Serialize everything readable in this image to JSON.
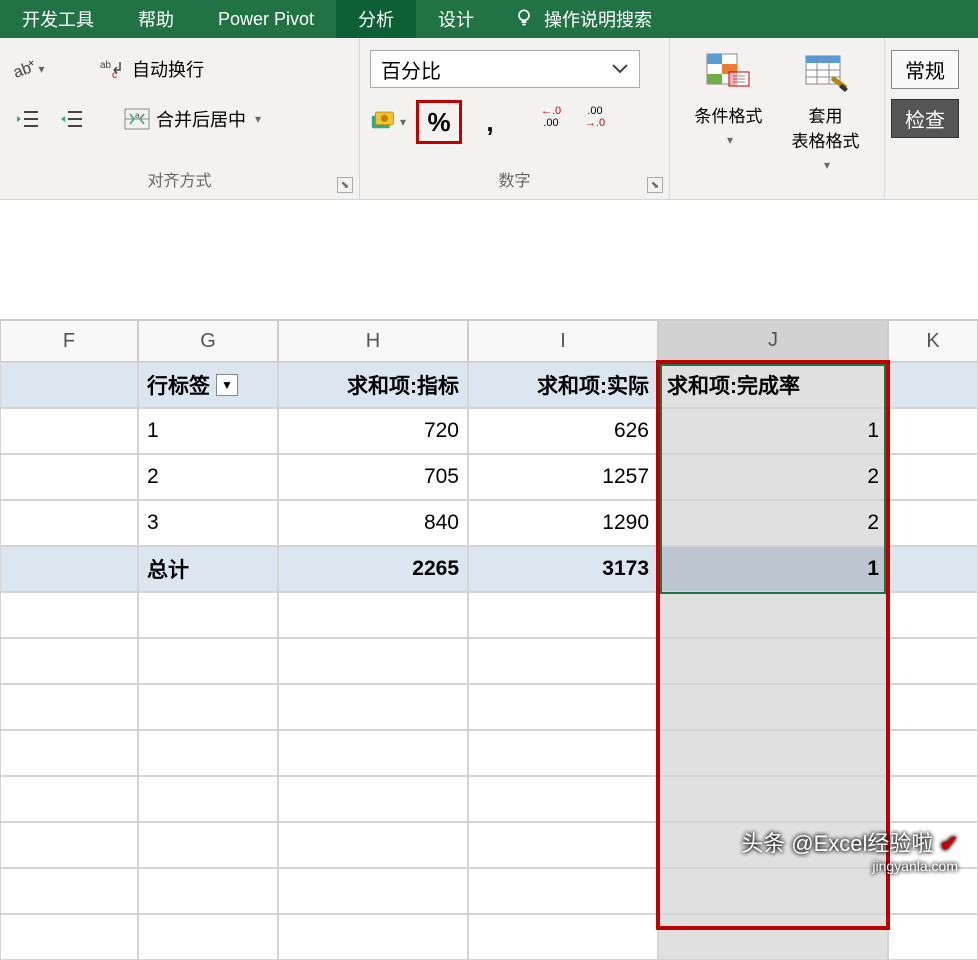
{
  "ribbon": {
    "tabs": {
      "dev": "开发工具",
      "help": "帮助",
      "powerpivot": "Power Pivot",
      "analyze": "分析",
      "design": "设计"
    },
    "tellme": "操作说明搜索",
    "align": {
      "wrap": "自动换行",
      "merge": "合并后居中",
      "group_label": "对齐方式"
    },
    "number": {
      "format": "百分比",
      "group_label": "数字",
      "comma": ",",
      "percent": "%"
    },
    "styles": {
      "cond": "条件格式",
      "table": "套用\n表格格式"
    },
    "right": {
      "normal": "常规",
      "check": "检查"
    }
  },
  "columns": {
    "F": "F",
    "G": "G",
    "H": "H",
    "I": "I",
    "J": "J",
    "K": "K"
  },
  "pivot": {
    "headers": {
      "rowlabel": "行标签",
      "col1": "求和项:指标",
      "col2": "求和项:实际",
      "col3": "求和项:完成率"
    },
    "rows": [
      {
        "label": "1",
        "v1": "720",
        "v2": "626",
        "v3": "1"
      },
      {
        "label": "2",
        "v1": "705",
        "v2": "1257",
        "v3": "2"
      },
      {
        "label": "3",
        "v1": "840",
        "v2": "1290",
        "v3": "2"
      }
    ],
    "total": {
      "label": "总计",
      "v1": "2265",
      "v2": "3173",
      "v3": "1"
    }
  },
  "chart_data": {
    "type": "table",
    "title": "数据透视表",
    "columns": [
      "行标签",
      "求和项:指标",
      "求和项:实际",
      "求和项:完成率"
    ],
    "rows": [
      [
        "1",
        720,
        626,
        1
      ],
      [
        "2",
        705,
        1257,
        2
      ],
      [
        "3",
        840,
        1290,
        2
      ],
      [
        "总计",
        2265,
        3173,
        1
      ]
    ]
  },
  "watermark": {
    "line1": "头条 @Excel经验啦",
    "line2": "jingyanla.com"
  }
}
